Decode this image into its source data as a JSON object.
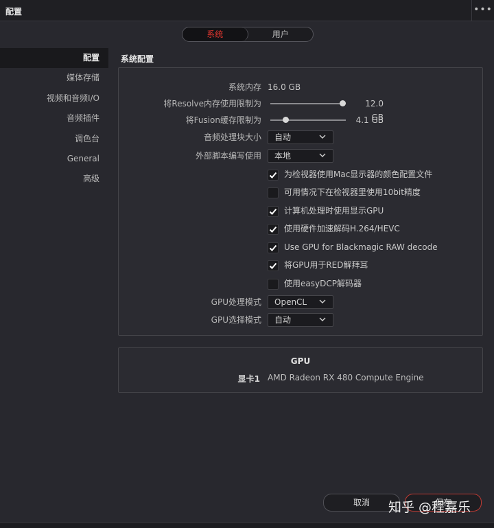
{
  "window": {
    "title": "配置",
    "more_icon": "more-dots-icon"
  },
  "tabs": [
    {
      "label": "系统",
      "active": true
    },
    {
      "label": "用户",
      "active": false
    }
  ],
  "sidebar": {
    "items": [
      {
        "label": "配置",
        "active": true
      },
      {
        "label": "媒体存储"
      },
      {
        "label": "视频和音频I/O"
      },
      {
        "label": "音频插件"
      },
      {
        "label": "调色台"
      },
      {
        "label": "General"
      },
      {
        "label": "高级"
      }
    ]
  },
  "section": {
    "title": "系统配置"
  },
  "system": {
    "memory": {
      "label": "系统内存",
      "value": "16.0 GB"
    },
    "resolve_limit": {
      "label": "将Resolve内存使用限制为",
      "value": "12.0 GB",
      "level": 1.0
    },
    "fusion_limit": {
      "label": "将Fusion缓存限制为",
      "value": "4.1 GB",
      "level": 0.18
    },
    "audio_block": {
      "label": "音频处理块大小",
      "selected": "自动"
    },
    "script_use": {
      "label": "外部脚本编写使用",
      "selected": "本地"
    },
    "checkboxes": [
      {
        "label": "为检视器使用Mac显示器的颜色配置文件",
        "checked": true
      },
      {
        "label": "可用情况下在检视器里使用10bit精度",
        "checked": false
      },
      {
        "label": "计算机处理时使用显示GPU",
        "checked": true
      },
      {
        "label": "使用硬件加速解码H.264/HEVC",
        "checked": true
      },
      {
        "label": "Use GPU for Blackmagic RAW decode",
        "checked": true
      },
      {
        "label": "将GPU用于RED解拜耳",
        "checked": true
      },
      {
        "label": "使用easyDCP解码器",
        "checked": false
      }
    ],
    "gpu_mode": {
      "label": "GPU处理模式",
      "selected": "OpenCL"
    },
    "gpu_select": {
      "label": "GPU选择模式",
      "selected": "自动"
    }
  },
  "gpu": {
    "title": "GPU",
    "card_label": "显卡1",
    "card_name": "AMD Radeon RX 480 Compute Engine"
  },
  "footer": {
    "cancel_label": "取消",
    "save_label": "保存"
  },
  "watermark": "知乎 @程嘉乐",
  "colors": {
    "accent": "#e0362f",
    "background": "#28282e",
    "panel": "#2b2b31"
  }
}
